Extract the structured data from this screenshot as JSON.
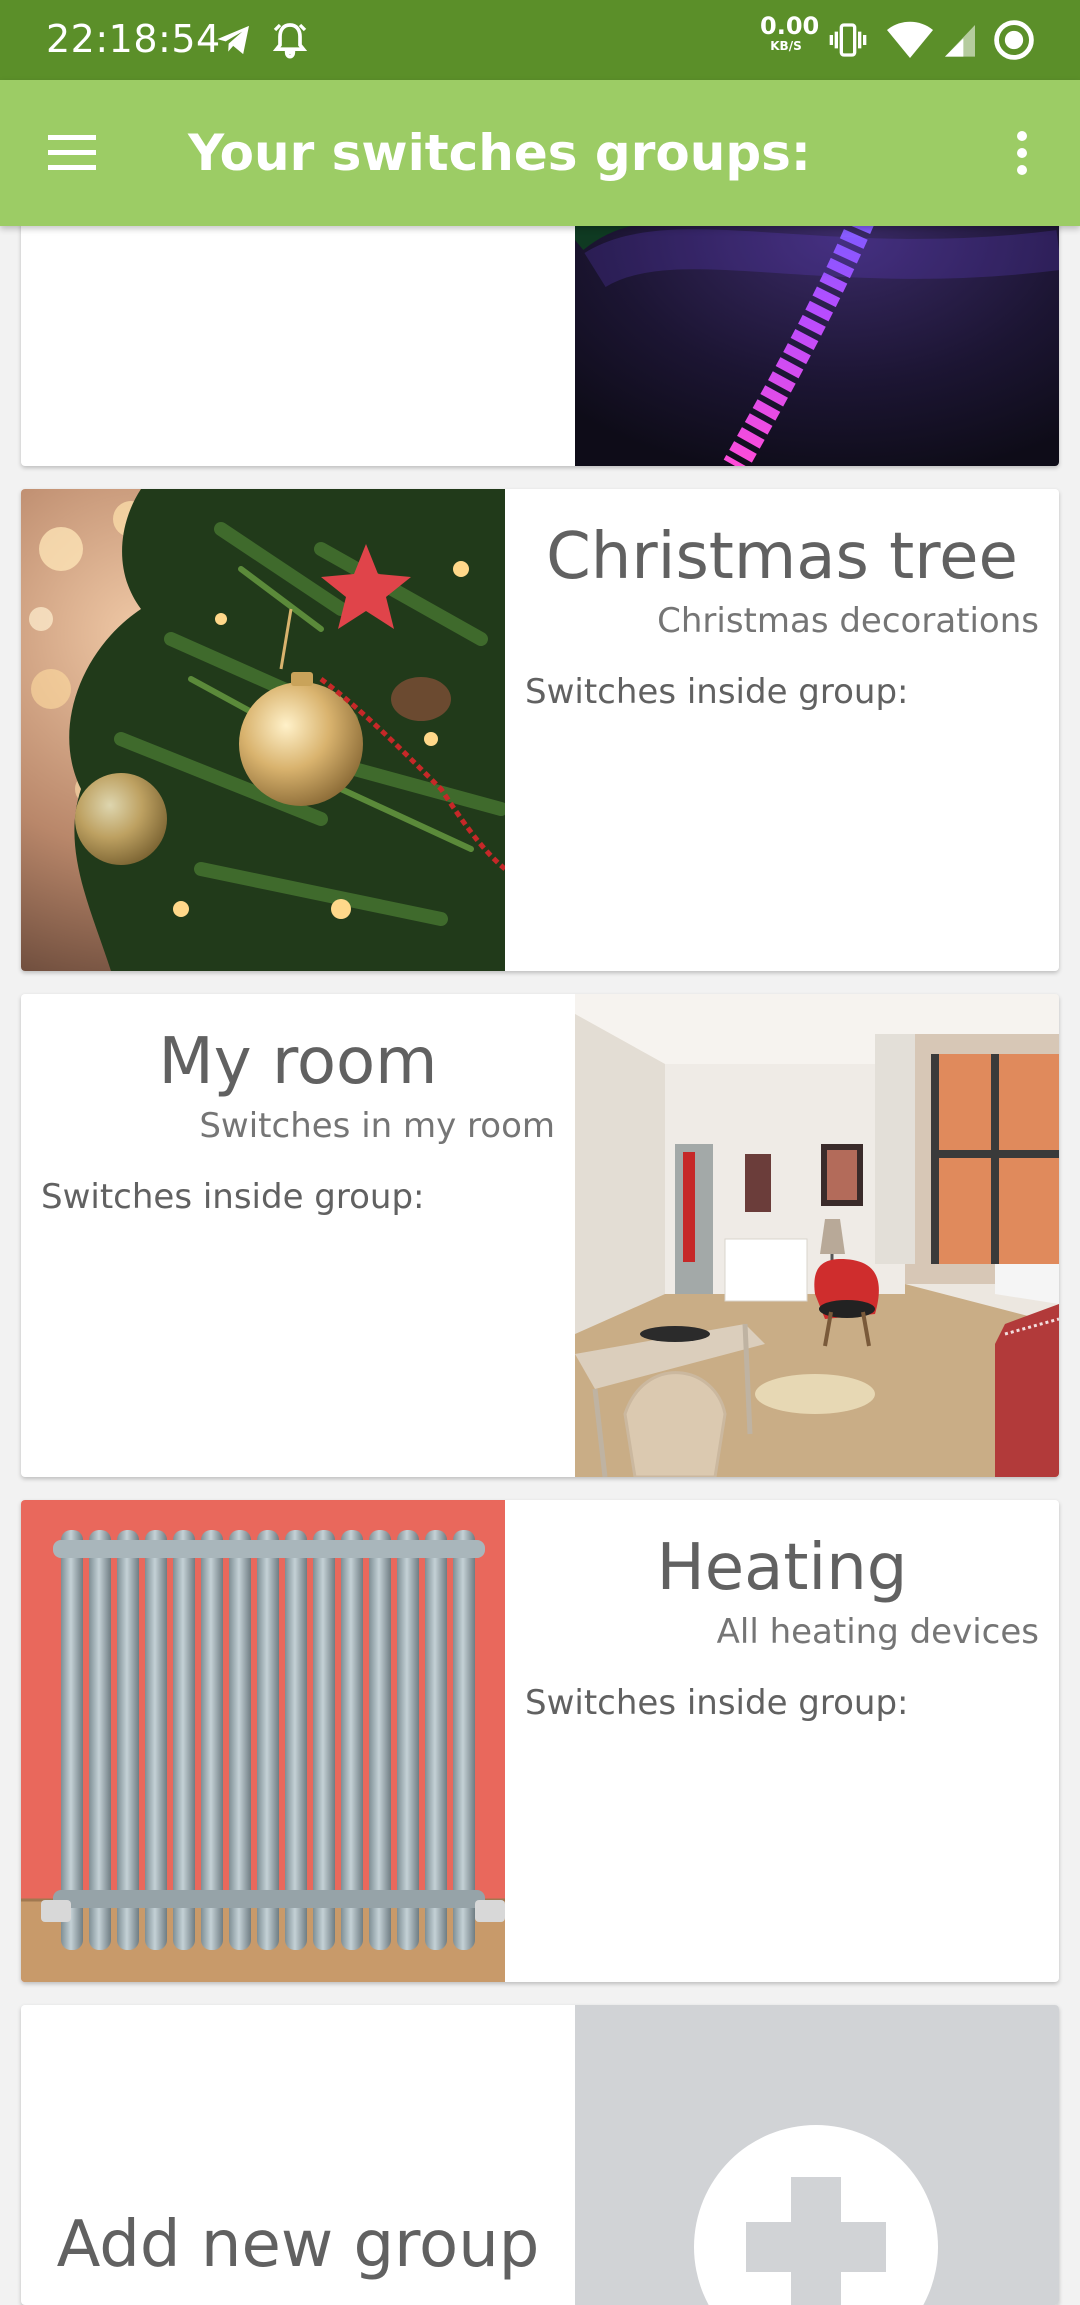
{
  "status_bar": {
    "time": "22:18:54",
    "net_speed": "0.00",
    "net_unit": "KB/S",
    "icons": [
      "telegram-icon",
      "alarm-icon",
      "vibrate-icon",
      "wifi-icon",
      "signal-icon",
      "sync-icon"
    ]
  },
  "app_bar": {
    "title": "Your switches groups:",
    "menu_icon": "hamburger-menu-icon",
    "overflow_icon": "more-vert-icon"
  },
  "colors": {
    "status_bar": "#5b8f29",
    "app_bar": "#9ccc65",
    "background": "#f2f2f2",
    "card": "#ffffff",
    "text": "#616161",
    "add_placeholder": "#d1d3d6"
  },
  "groups": [
    {
      "title": "",
      "subtitle": "",
      "switches_label": "",
      "image": "led-strip-photo"
    },
    {
      "title": "Christmas tree",
      "subtitle": "Christmas decorations",
      "switches_label": "Switches inside group:",
      "image": "christmas-tree-photo"
    },
    {
      "title": "My room",
      "subtitle": "Switches in my room",
      "switches_label": "Switches inside group:",
      "image": "room-interior-photo"
    },
    {
      "title": "Heating",
      "subtitle": "All heating devices",
      "switches_label": "Switches inside group:",
      "image": "radiator-photo"
    }
  ],
  "add_group": {
    "label": "Add new group",
    "icon": "add-circle-icon"
  }
}
